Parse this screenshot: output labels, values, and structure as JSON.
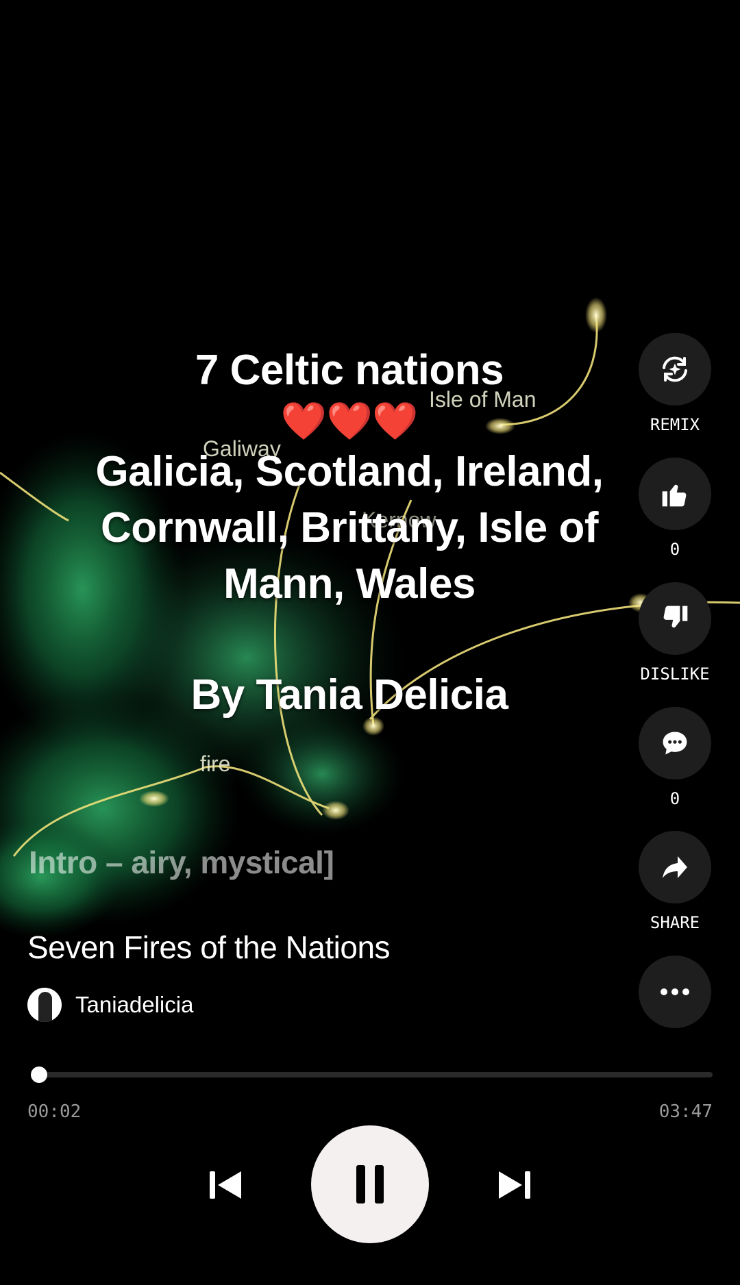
{
  "caption": {
    "line1": "7 Celtic nations",
    "hearts": "❤️❤️❤️",
    "line2": "Galicia, Scotland, Ireland,",
    "line3": "Cornwall, Brittany, Isle of",
    "line4": "Mann, Wales",
    "byline": "By Tania Delicia"
  },
  "background_labels": {
    "isle_of_man": "Isle of Man",
    "galway": "Galiway",
    "kernow": "Kernow",
    "fire": "fire"
  },
  "lyric": "Intro – airy, mystical]",
  "song": {
    "title": "Seven Fires of the Nations",
    "artist": "Taniadelicia"
  },
  "actions": {
    "remix_label": "REMIX",
    "like_count": "0",
    "dislike_label": "DISLIKE",
    "comment_count": "0",
    "share_label": "SHARE"
  },
  "player": {
    "elapsed": "00:02",
    "duration": "03:47",
    "progress_fraction": 0.009
  },
  "icons": {
    "remix": "remix-icon",
    "like": "thumbs-up-icon",
    "dislike": "thumbs-down-icon",
    "comment": "comment-icon",
    "share": "share-icon",
    "more": "more-icon",
    "prev": "skip-previous-icon",
    "pause": "pause-icon",
    "next": "skip-next-icon"
  },
  "colors": {
    "glow_green": "#1f8a4c",
    "glow_yellow": "#f3e27a",
    "button_bg": "#1e1e1e",
    "play_bg": "#f4f0ef"
  }
}
